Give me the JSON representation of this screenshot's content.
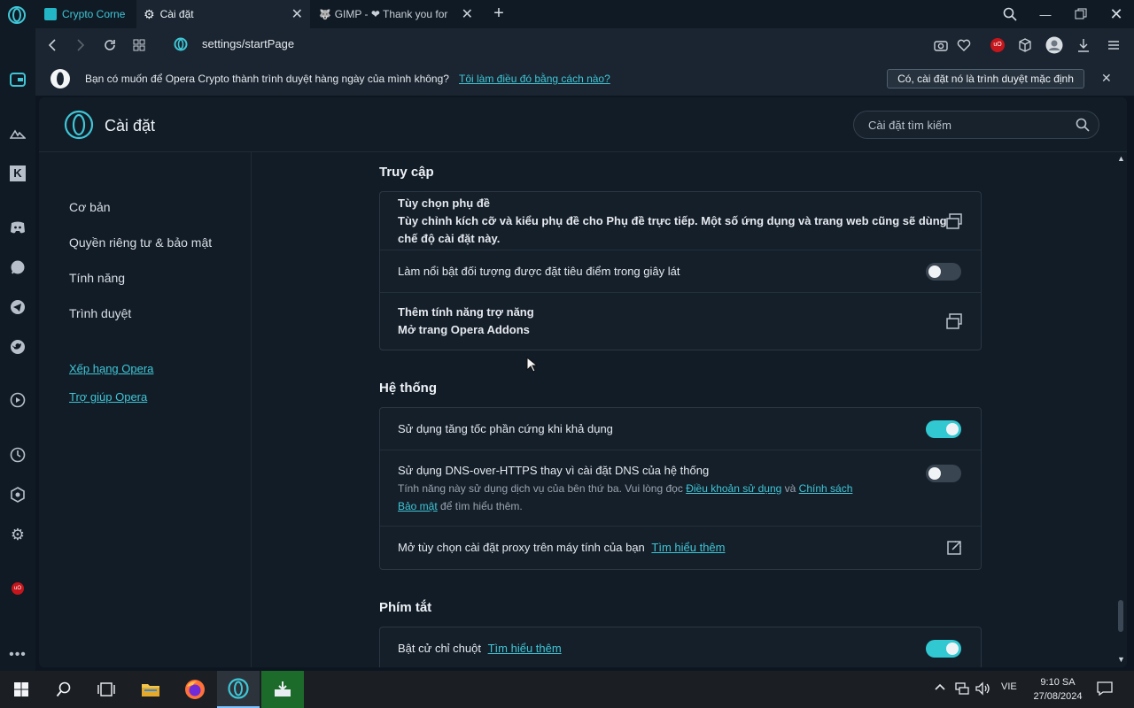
{
  "tabs": [
    {
      "label": "Crypto Corne",
      "active": false
    },
    {
      "label": "Cài đặt",
      "active": true
    },
    {
      "label": "GIMP - ❤ Thank you for",
      "active": false
    }
  ],
  "address": {
    "url": "settings/startPage"
  },
  "banner": {
    "message": "Bạn có muốn để Opera Crypto thành trình duyệt hàng ngày của mình không?",
    "link": "Tôi làm điều đó bằng cách nào?",
    "button": "Có, cài đặt nó là trình duyệt mặc định"
  },
  "settings": {
    "title": "Cài đặt",
    "search_placeholder": "Cài đặt tìm kiếm"
  },
  "leftnav": {
    "items": [
      "Cơ bản",
      "Quyền riêng tư & bảo mật",
      "Tính năng",
      "Trình duyệt"
    ],
    "links": [
      "Xếp hạng Opera",
      "Trợ giúp Opera"
    ]
  },
  "sections": {
    "accessibility": {
      "title": "Truy cập",
      "captions_title": "Tùy chọn phụ đề",
      "captions_desc_1": "Tùy chỉnh kích cỡ và kiểu phụ đề cho Phụ đề trực tiếp. Một số ứng dụng và trang web cũng sẽ dùng",
      "captions_desc_2": "chế độ cài đặt này.",
      "highlight_focus": "Làm nổi bật đối tượng được đặt tiêu điểm trong giây lát",
      "highlight_focus_on": false,
      "addons_title": "Thêm tính năng trợ năng",
      "addons_desc": "Mở trang Opera Addons"
    },
    "system": {
      "title": "Hệ thống",
      "hw_accel": "Sử dụng tăng tốc phần cứng khi khả dụng",
      "hw_accel_on": true,
      "doh_title": "Sử dụng DNS-over-HTTPS thay vì cài đặt DNS của hệ thống",
      "doh_desc_1": "Tính năng này sử dụng dịch vụ của bên thứ ba. Vui lòng đọc",
      "doh_link_terms": "Điều khoản sử dụng",
      "doh_and": "và",
      "doh_link_policy_1": "Chính sách",
      "doh_link_policy_2": "Bảo mật",
      "doh_desc_2": "để tìm hiểu thêm.",
      "doh_on": false,
      "proxy": "Mở tùy chọn cài đặt proxy trên máy tính của bạn",
      "proxy_link": "Tìm hiểu thêm"
    },
    "shortcuts": {
      "title": "Phím tắt",
      "mouse_gestures": "Bật cử chỉ chuột",
      "mouse_gestures_link": "Tìm hiểu thêm",
      "mouse_gestures_on": true
    }
  },
  "taskbar": {
    "language": "VIE",
    "time": "9:10 SA",
    "date": "27/08/2024"
  },
  "colors": {
    "accent": "#32c8d2",
    "link": "#3fc6d6",
    "background": "#121c27"
  }
}
